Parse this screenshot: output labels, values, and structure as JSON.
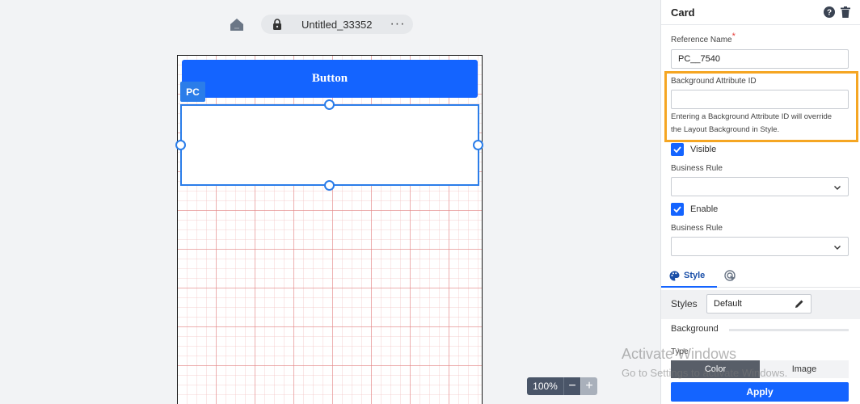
{
  "toolbar": {
    "home_icon": "home-icon",
    "lock_icon": "lock-icon",
    "title": "Untitled_33352",
    "more": "···"
  },
  "canvas": {
    "button_label": "Button",
    "badge": "PC"
  },
  "zoom": {
    "level": "100%",
    "minus": "−",
    "plus": "+"
  },
  "panel": {
    "title": "Card",
    "reference_name": {
      "label": "Reference Name",
      "required": "*",
      "value": "PC__7540"
    },
    "background_attribute": {
      "label": "Background Attribute ID",
      "value": "",
      "help": "Entering a Background Attribute ID will override the Layout Background in Style."
    },
    "visible": {
      "label": "Visible",
      "checked": true
    },
    "business_rule_1": {
      "label": "Business Rule",
      "value": ""
    },
    "enable": {
      "label": "Enable",
      "checked": true
    },
    "business_rule_2": {
      "label": "Business Rule",
      "value": ""
    },
    "tabs": {
      "style": "Style"
    },
    "styles": {
      "label": "Styles",
      "value": "Default"
    },
    "background": {
      "label": "Background",
      "type_label": "Type",
      "options": [
        "Color",
        "Image"
      ],
      "selected": "Color"
    },
    "apply": "Apply"
  },
  "watermark": {
    "line1": "Activate Windows",
    "line2": "Go to Settings to activate Windows."
  },
  "colors": {
    "primary": "#1464ff",
    "selection": "#2b7de9",
    "highlight": "#f5a623"
  }
}
